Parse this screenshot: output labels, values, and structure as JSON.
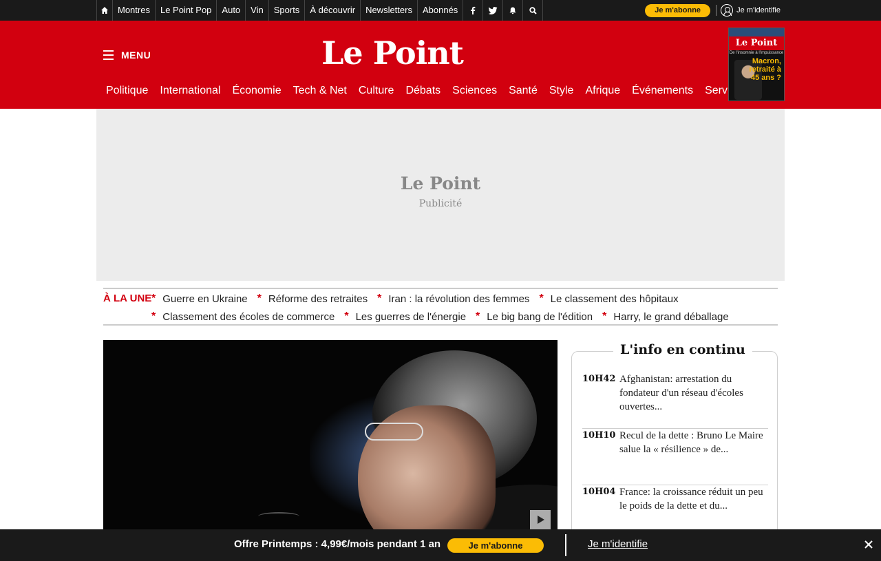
{
  "topbar": {
    "links": [
      "Montres",
      "Le Point Pop",
      "Auto",
      "Vin",
      "Sports",
      "À découvrir",
      "Newsletters",
      "Abonnés"
    ],
    "social_icons": [
      "facebook-icon",
      "twitter-icon",
      "bell-icon",
      "search-icon"
    ],
    "subscribe_label": "Je m'abonne",
    "login_label": "Je m'identifie"
  },
  "header": {
    "menu_label": "MENU",
    "logo": "Le Point",
    "nav": [
      "Politique",
      "International",
      "Économie",
      "Tech & Net",
      "Culture",
      "Débats",
      "Sciences",
      "Santé",
      "Style",
      "Afrique",
      "Événements",
      "Services"
    ],
    "cover": {
      "logo": "Le Point",
      "kicker": "De l'insomnie à l'impuissance",
      "headline_1": "Macron,",
      "headline_2": "retraité à",
      "headline_3": "45 ans ?"
    }
  },
  "ad": {
    "logo": "Le Point",
    "label": "Publicité"
  },
  "une": {
    "label": "À LA UNE",
    "row1": [
      "Guerre en Ukraine",
      "Réforme des retraites",
      "Iran : la révolution des femmes",
      "Le classement des hôpitaux"
    ],
    "row2": [
      "Classement des écoles de commerce",
      "Les guerres de l'énergie",
      "Le big bang de l'édition",
      "Harry, le grand déballage"
    ]
  },
  "feed": {
    "title": "L'info en continu",
    "items": [
      {
        "time": "10H42",
        "text": "Afghanistan: arrestation du fondateur d'un réseau d'écoles ouvertes..."
      },
      {
        "time": "10H10",
        "text": "Recul de la dette : Bruno Le Maire salue la « résilience » de..."
      },
      {
        "time": "10H04",
        "text": "France: la croissance réduit un peu le poids de la dette et du..."
      }
    ]
  },
  "offer": {
    "text": "Offre Printemps : 4,99€/mois pendant 1 an",
    "button": "Je m'abonne",
    "login": "Je m'identifie"
  },
  "colors": {
    "brand_red": "#d2000f",
    "accent_yellow": "#fbbc05",
    "dark_bar": "#1a1a1a"
  }
}
